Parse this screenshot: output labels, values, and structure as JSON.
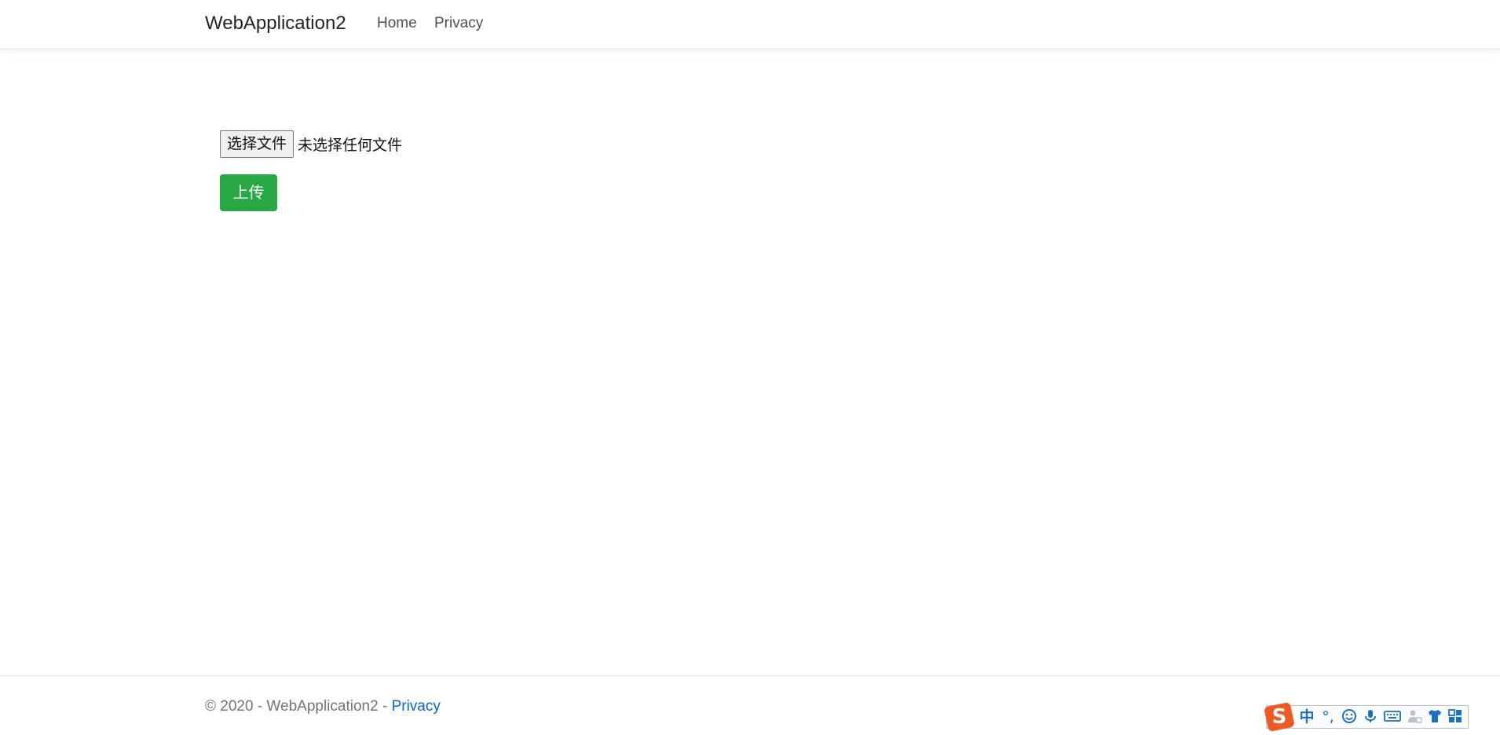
{
  "navbar": {
    "brand": "WebApplication2",
    "links": [
      {
        "label": "Home"
      },
      {
        "label": "Privacy"
      }
    ]
  },
  "upload_form": {
    "file_button_label": "选择文件",
    "file_status": "未选择任何文件",
    "submit_label": "上传",
    "submit_color": "#28a745"
  },
  "footer": {
    "text": "© 2020 - WebApplication2 - ",
    "link_label": "Privacy",
    "link_color": "#0366d6"
  },
  "ime_toolbar": {
    "logo_letter": "S",
    "mode_label": "中",
    "punct_label": "°,",
    "icons": [
      "emoji-icon",
      "microphone-icon",
      "keyboard-icon",
      "user-icon",
      "skin-shirt-icon",
      "grid-menu-icon"
    ],
    "accent_color": "#1a6fc7",
    "logo_color": "#ee5a24"
  }
}
